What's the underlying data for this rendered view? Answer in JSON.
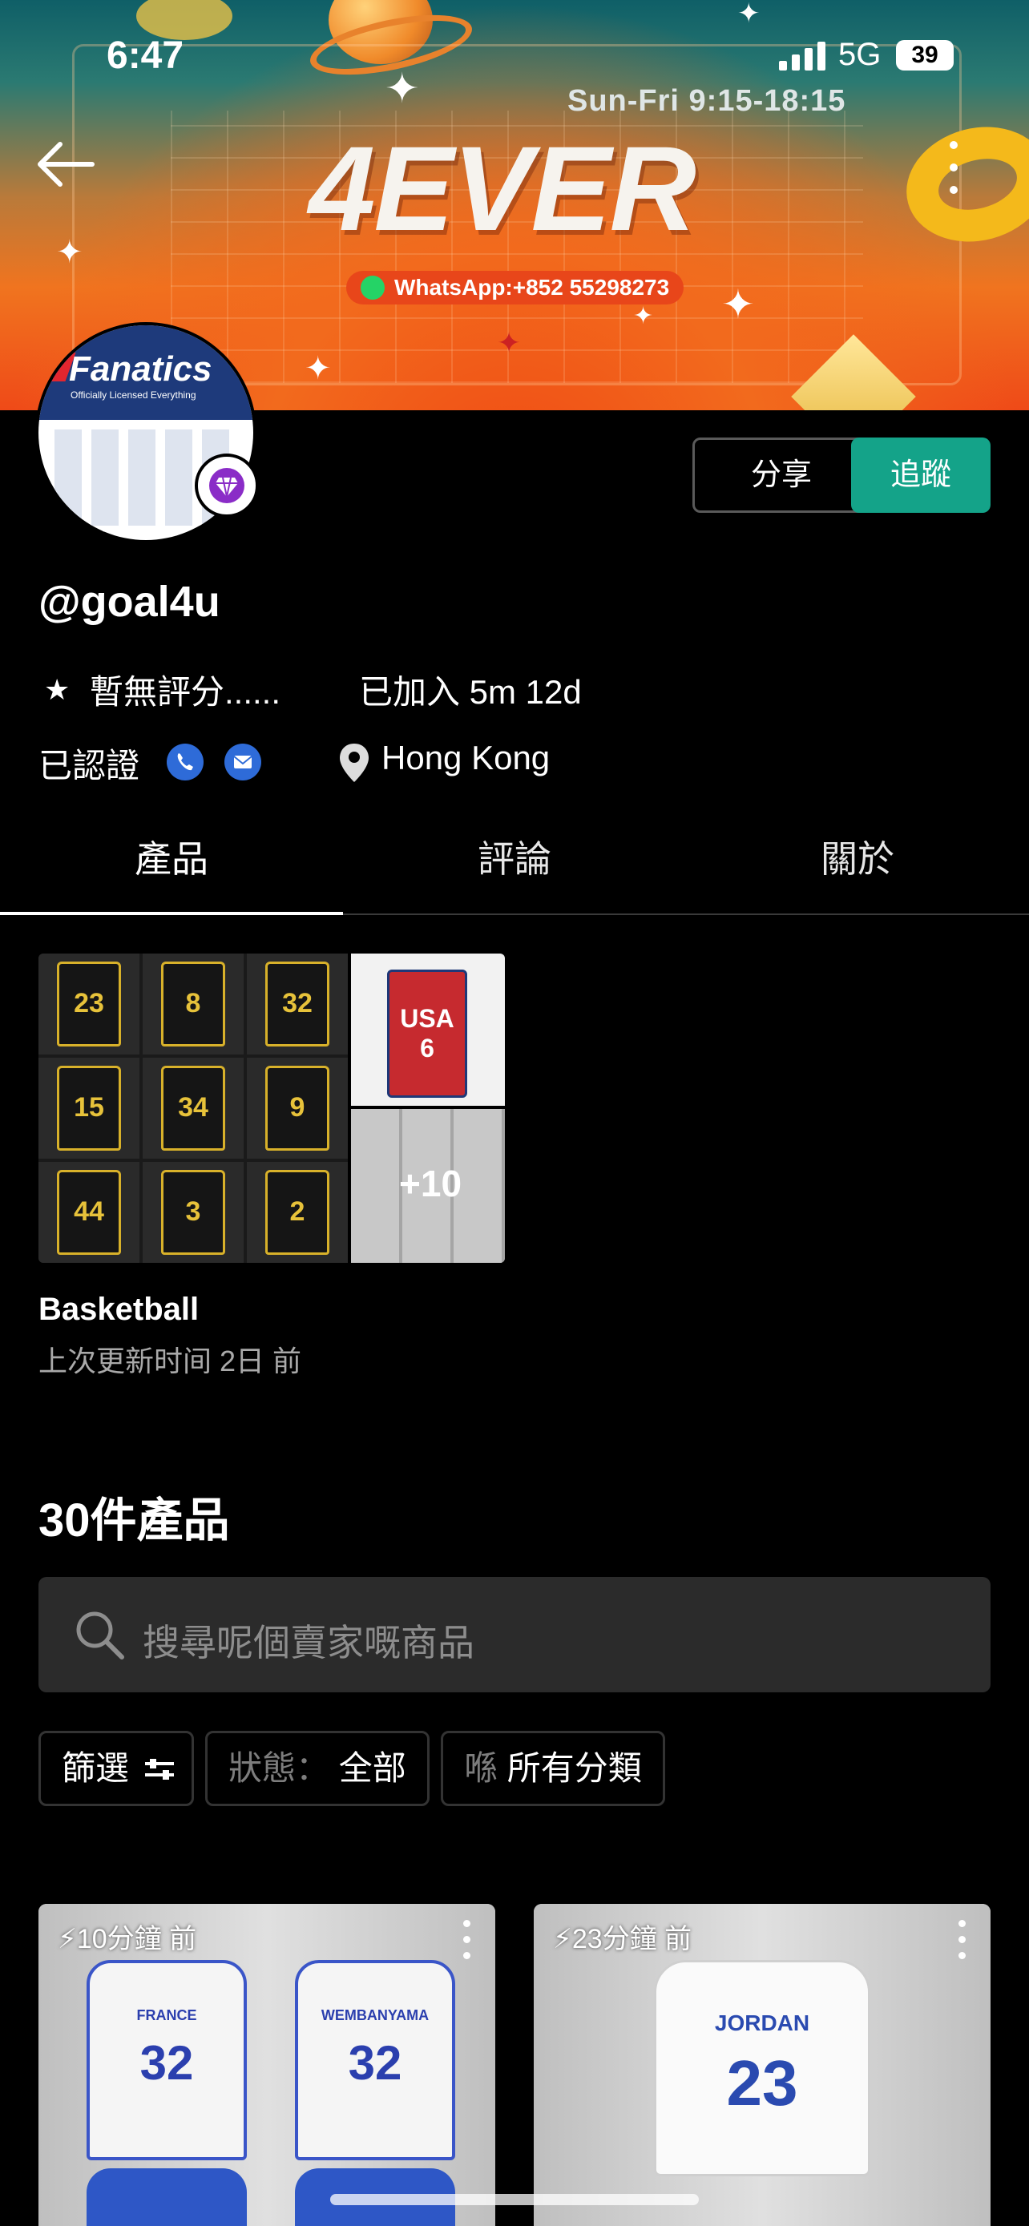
{
  "status_bar": {
    "time": "6:47",
    "network": "5G",
    "battery": "39"
  },
  "banner": {
    "hours": "Sun-Fri 9:15-18:15",
    "logo": "4EVER",
    "whatsapp": "WhatsApp:+852 55298273"
  },
  "avatar": {
    "brand": "Fanatics",
    "tagline": "Officially Licensed Everything"
  },
  "profile": {
    "share_label": "分享",
    "follow_label": "追蹤",
    "username": "@goal4u",
    "rating": "暫無評分......",
    "joined": "已加入 5m 12d",
    "verified": "已認證",
    "location": "Hong Kong"
  },
  "tabs": [
    {
      "label": "產品",
      "active": true
    },
    {
      "label": "評論",
      "active": false
    },
    {
      "label": "關於",
      "active": false
    }
  ],
  "collection": {
    "more_count": "+10",
    "name": "Basketball",
    "updated": "上次更新时间 2日 前",
    "jersey_numbers": [
      "23",
      "8",
      "32",
      "15",
      "34",
      "9",
      "44",
      "3",
      "2"
    ],
    "side_jersey": {
      "label": "USA",
      "number": "6"
    }
  },
  "products": {
    "count_label": "30件產品",
    "search_placeholder": "搜尋呢個賣家嘅商品",
    "filter_label": "篩選",
    "status_prefix": "狀態：",
    "status_value": "全部",
    "category_prefix": "喺",
    "category_value": "所有分類",
    "cards": [
      {
        "time": "10分鐘 前",
        "names": [
          "FRANCE",
          "WEMBANYAMA"
        ],
        "numbers": [
          "32",
          "32"
        ]
      },
      {
        "time": "23分鐘 前",
        "name": "JORDAN",
        "number": "23"
      }
    ]
  },
  "colors": {
    "accent": "#14a389",
    "verified_icon": "#2e6bd8",
    "gem": "#8a2cc7"
  },
  "icons": [
    "back-arrow-icon",
    "more-vertical-icon",
    "diamond-icon",
    "star-icon",
    "phone-icon",
    "mail-icon",
    "location-pin-icon",
    "search-icon",
    "sliders-icon",
    "lightning-icon"
  ]
}
